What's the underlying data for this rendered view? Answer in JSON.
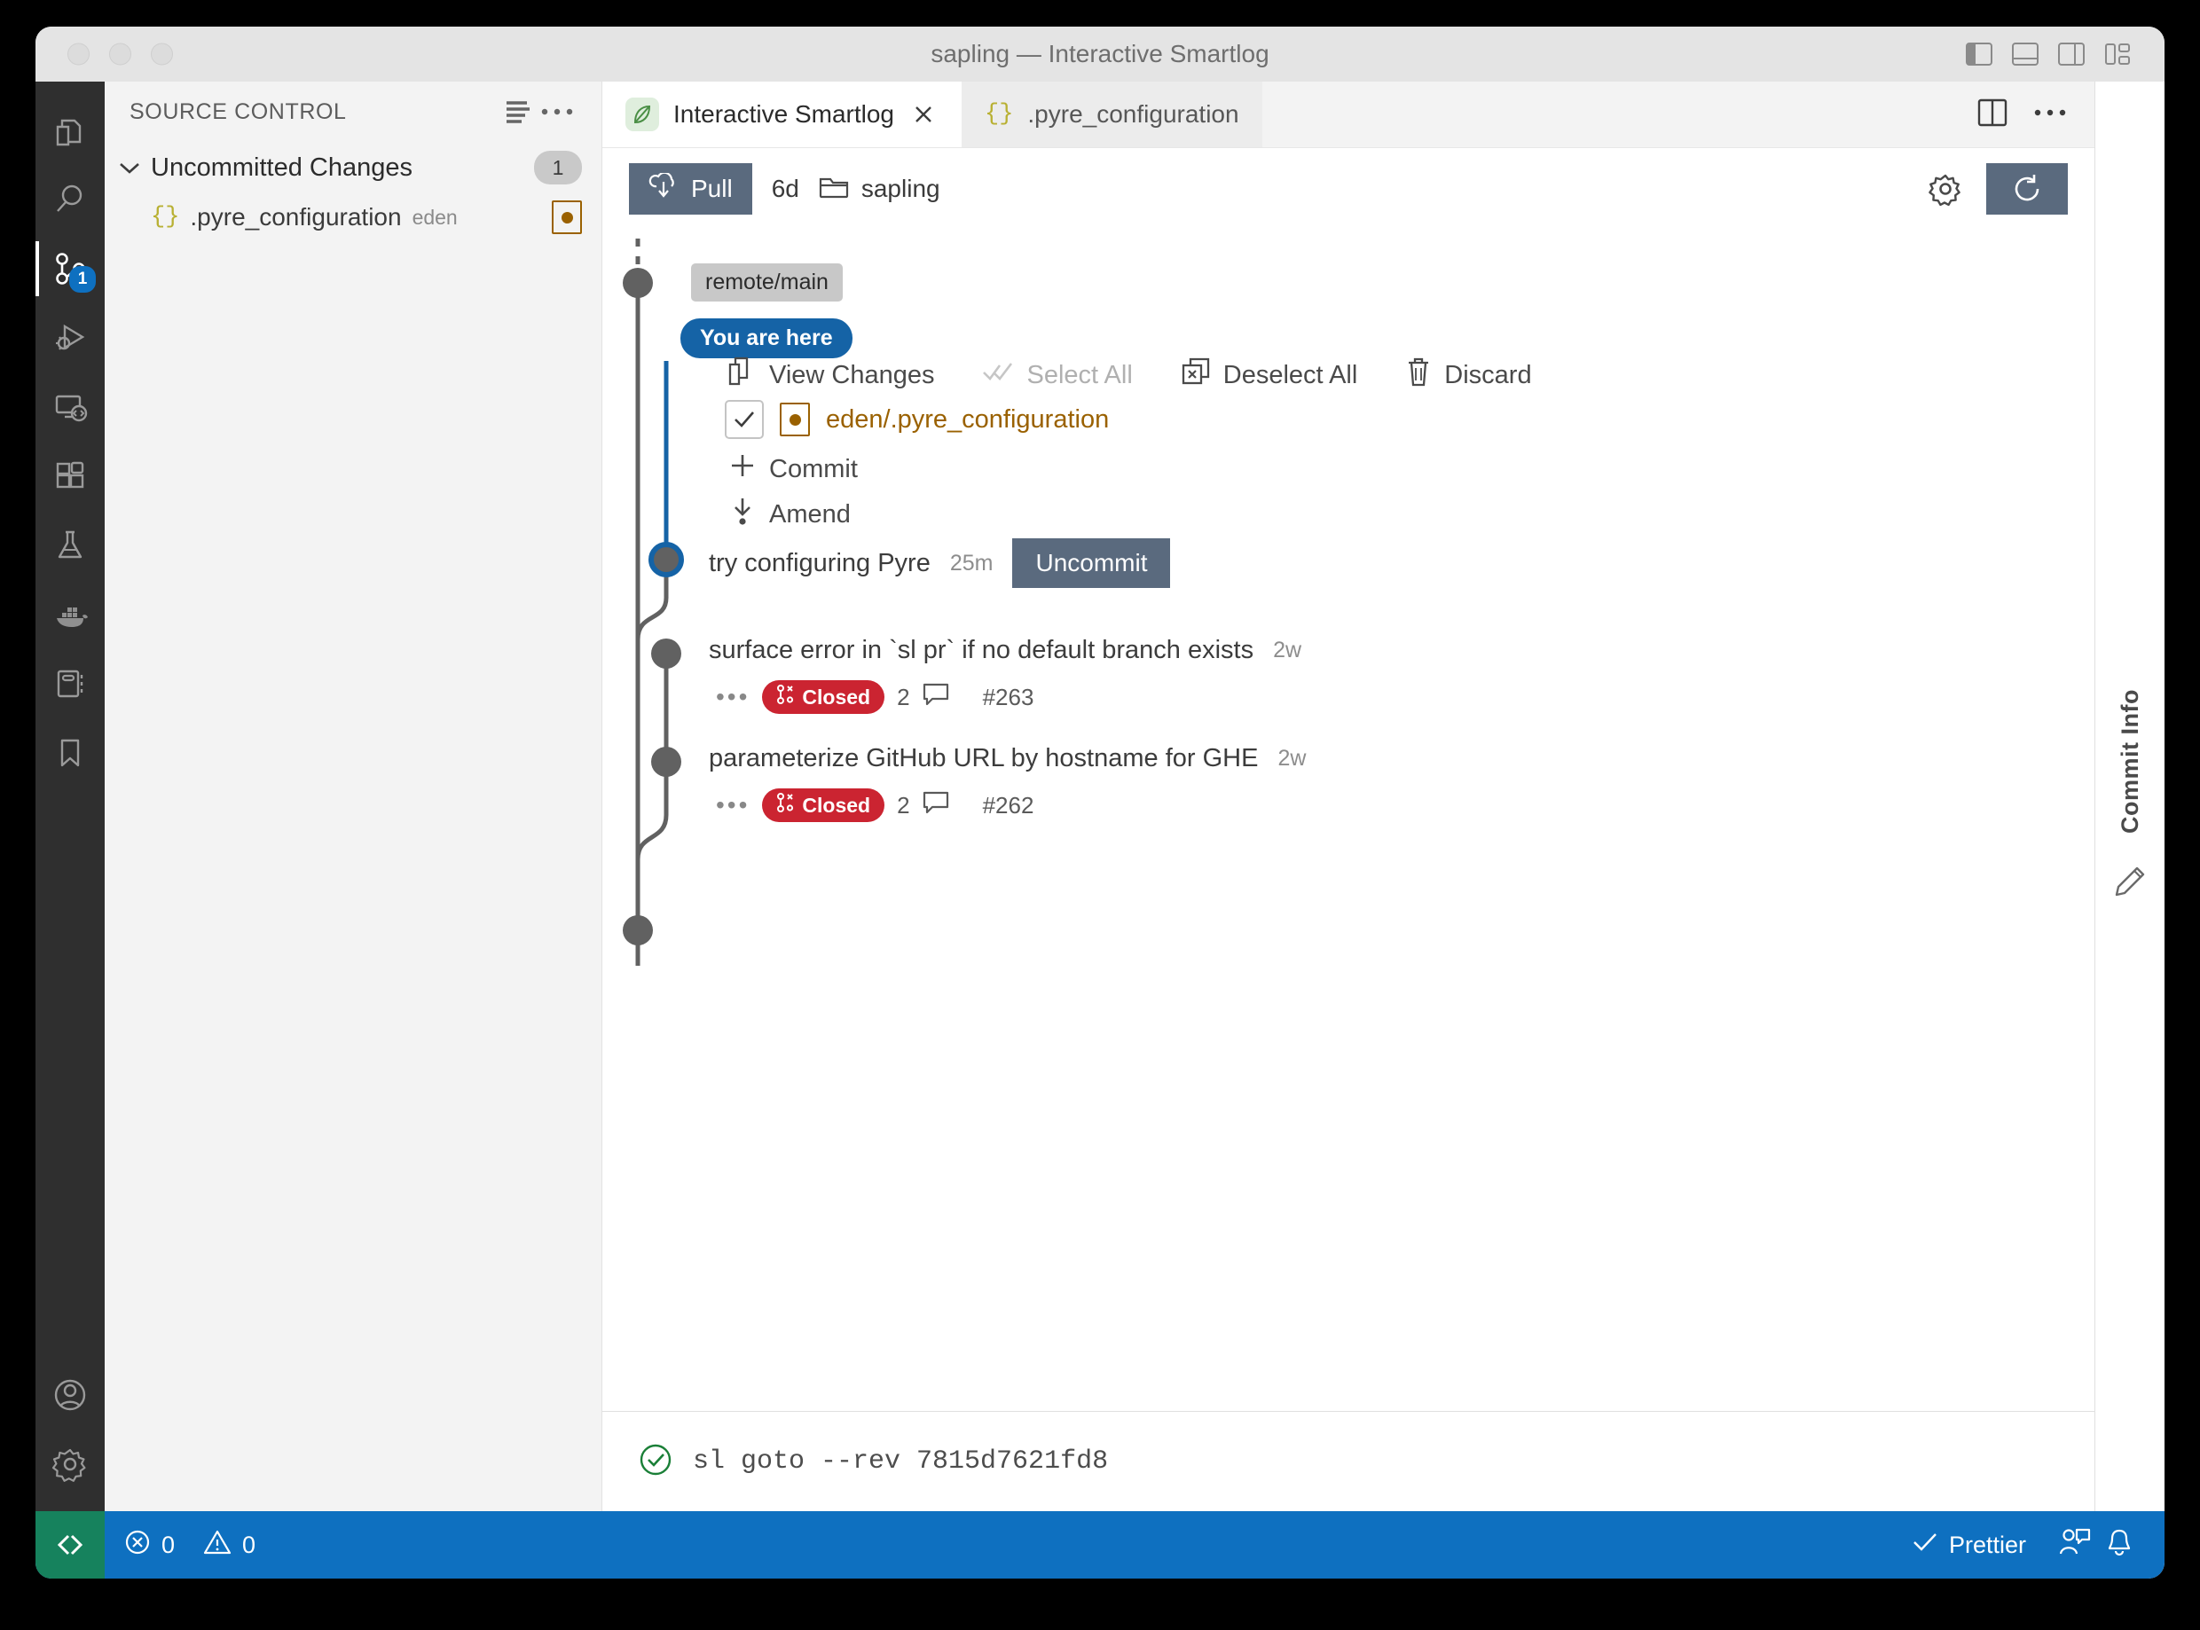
{
  "window": {
    "title": "sapling — Interactive Smartlog",
    "traffic_lights": [
      "close",
      "minimize",
      "zoom"
    ],
    "layout_controls": [
      {
        "name": "toggle-primary-sidebar",
        "label": "Toggle Primary Side Bar"
      },
      {
        "name": "toggle-panel",
        "label": "Toggle Panel"
      },
      {
        "name": "toggle-secondary-sidebar",
        "label": "Toggle Secondary Side Bar"
      },
      {
        "name": "customize-layout",
        "label": "Customize Layout"
      }
    ]
  },
  "activity_bar": {
    "items": [
      {
        "icon": "files-icon",
        "label": "Explorer",
        "active": false,
        "badge": null
      },
      {
        "icon": "search-icon",
        "label": "Search",
        "active": false,
        "badge": null
      },
      {
        "icon": "source-control-icon",
        "label": "Source Control",
        "active": true,
        "badge": "1"
      },
      {
        "icon": "run-debug-icon",
        "label": "Run and Debug",
        "active": false,
        "badge": null
      },
      {
        "icon": "remote-explorer-icon",
        "label": "Remote Explorer",
        "active": false,
        "badge": null
      },
      {
        "icon": "extensions-icon",
        "label": "Extensions",
        "active": false,
        "badge": null
      },
      {
        "icon": "testing-beaker-icon",
        "label": "Testing",
        "active": false,
        "badge": null
      },
      {
        "icon": "docker-whale-icon",
        "label": "Docker",
        "active": false,
        "badge": null
      },
      {
        "icon": "notebook-icon",
        "label": "Notebook",
        "active": false,
        "badge": null
      },
      {
        "icon": "bookmark-icon",
        "label": "Bookmarks",
        "active": false,
        "badge": null
      }
    ],
    "bottom_items": [
      {
        "icon": "account-icon",
        "label": "Accounts"
      },
      {
        "icon": "gear-icon",
        "label": "Manage"
      }
    ]
  },
  "sidebar": {
    "title": "SOURCE CONTROL",
    "header_actions": [
      {
        "icon": "view-as-list-icon",
        "label": "View as List"
      },
      {
        "icon": "more-actions-icon",
        "label": "Views and More Actions..."
      }
    ],
    "section": {
      "label": "Uncommitted Changes",
      "count": "1",
      "expanded": true
    },
    "files": [
      {
        "icon": "json-braces-icon",
        "name": ".pyre_configuration",
        "directory": "eden",
        "status_badge": "modified"
      }
    ]
  },
  "editor": {
    "tabs": [
      {
        "icon": "sapling-leaf-icon",
        "label": "Interactive Smartlog",
        "active": true,
        "closable": true
      },
      {
        "icon": "json-braces-icon",
        "label": ".pyre_configuration",
        "active": false,
        "closable": false
      }
    ],
    "tab_actions": [
      {
        "icon": "split-editor-icon",
        "label": "Split Editor"
      },
      {
        "icon": "more-actions-icon",
        "label": "More Actions..."
      }
    ]
  },
  "smartlog": {
    "toolbar": {
      "pull_label": "Pull",
      "pull_icon": "cloud-download-icon",
      "last_fetch": "6d",
      "repo_icon": "folder-icon",
      "repo_name": "sapling",
      "settings_icon": "gear-icon",
      "refresh_icon": "refresh-icon"
    },
    "bookmark": "remote/main",
    "you_are_here": "You are here",
    "uncommitted_actions": [
      {
        "icon": "view-changes-icon",
        "label": "View Changes",
        "disabled": false
      },
      {
        "icon": "select-all-icon",
        "label": "Select All",
        "disabled": true
      },
      {
        "icon": "deselect-all-icon",
        "label": "Deselect All",
        "disabled": false
      },
      {
        "icon": "trash-icon",
        "label": "Discard",
        "disabled": false
      }
    ],
    "changed_files": [
      {
        "checked": true,
        "status": "modified",
        "path": "eden/.pyre_configuration"
      }
    ],
    "commit_actions": [
      {
        "icon": "plus-icon",
        "label": "Commit"
      },
      {
        "icon": "amend-icon",
        "label": "Amend"
      }
    ],
    "head_commit": {
      "title": "try configuring Pyre",
      "age": "25m",
      "button": "Uncommit"
    },
    "commits": [
      {
        "title": "surface error in `sl pr` if no default branch exists",
        "age": "2w",
        "pr_status": "Closed",
        "pr_status_icon": "pull-request-closed-icon",
        "comments": "2",
        "comments_icon": "comment-icon",
        "number": "#263",
        "overflow_icon": "ellipsis-icon"
      },
      {
        "title": "parameterize GitHub URL by hostname for GHE",
        "age": "2w",
        "pr_status": "Closed",
        "pr_status_icon": "pull-request-closed-icon",
        "comments": "2",
        "comments_icon": "comment-icon",
        "number": "#262",
        "overflow_icon": "ellipsis-icon"
      }
    ],
    "command_output": {
      "status_icon": "check-circle-icon",
      "text": "sl goto --rev 7815d7621fd8"
    }
  },
  "right_rail": {
    "label": "Commit Info",
    "icon": "pencil-icon"
  },
  "status_bar": {
    "remote_icon": "remote-window-icon",
    "errors_icon": "error-circle-icon",
    "errors": "0",
    "warnings_icon": "warning-triangle-icon",
    "warnings": "0",
    "formatter_icon": "check-icon",
    "formatter": "Prettier",
    "live_share_icon": "live-share-icon",
    "bell_icon": "bell-icon"
  },
  "colors": {
    "accent_blue": "#0e70c0",
    "button_slate": "#5a6a7e",
    "closed_red": "#cb2431",
    "modified_amber": "#9a6100",
    "remote_green": "#16825d",
    "graph_gray": "#616161",
    "graph_blue": "#1563a6"
  }
}
